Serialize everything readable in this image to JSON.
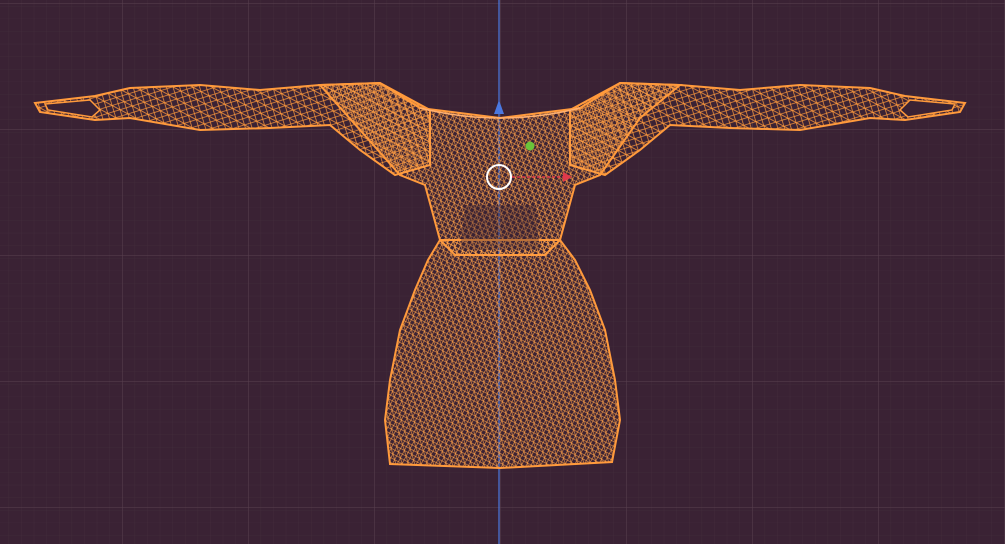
{
  "viewport": {
    "view": "front-orthographic",
    "shading": "wireframe",
    "colors": {
      "background": "#3a2234",
      "grid_minor": "#48303f",
      "grid_major": "#5a4150",
      "mesh_selected": "#ff9a3c",
      "z_axis": "#4a78e0",
      "x_axis": "#e03a4a",
      "y_axis": "#6ac43a",
      "cursor": "#ffffff"
    }
  },
  "scene": {
    "object": {
      "type": "dress-mesh",
      "selected": true,
      "display": "wireframe"
    },
    "cursor_icon": "3d-cursor-icon",
    "gizmo_icon": "transform-gizmo-icon"
  }
}
